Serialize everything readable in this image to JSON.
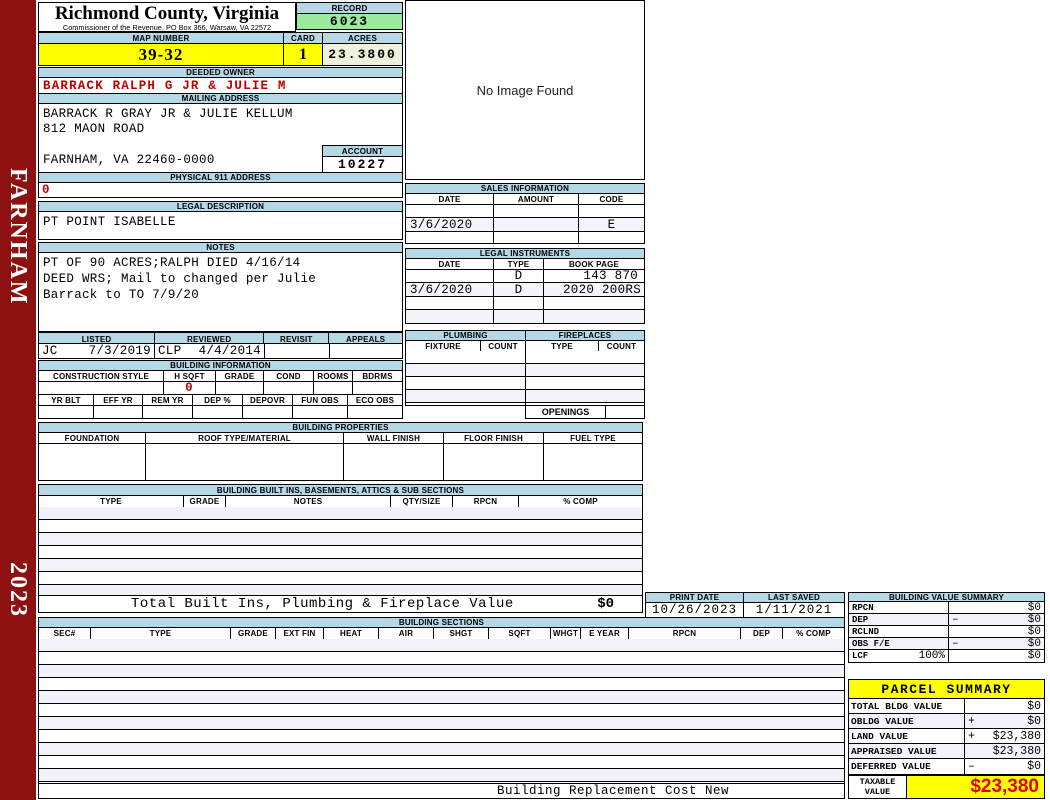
{
  "colors": {
    "sidebar_red": "#8E1111",
    "section_header_blue": "#B4D8E6",
    "record_green": "#9CEB9C",
    "highlight_yellow": "#FFFF00",
    "acres_beige": "#EFEFDC",
    "alert_red": "#C00000",
    "taxable_red": "#E60000",
    "row_stripe": "#F1F2FA"
  },
  "sidebar": {
    "district": "FARNHAM",
    "year": "2023"
  },
  "county_header": {
    "title": "Richmond County, Virginia",
    "subtitle": "Commissioner of the Revenue, PO Box 366, Warsaw, VA 22572"
  },
  "record": {
    "label": "RECORD",
    "value": "6023"
  },
  "parcel_header": {
    "map_number_label": "MAP NUMBER",
    "map_number": "39-32",
    "card_label": "CARD",
    "card": "1",
    "acres_label": "ACRES",
    "acres": "23.3800"
  },
  "owner": {
    "deeded_owner_label": "DEEDED OWNER",
    "deeded_owner": "BARRACK RALPH G JR & JULIE M",
    "mailing_label": "MAILING ADDRESS",
    "mailing_lines": [
      "BARRACK R GRAY JR & JULIE KELLUM",
      "812 MAON ROAD",
      "FARNHAM, VA 22460-0000"
    ],
    "account_label": "ACCOUNT",
    "account": "10227",
    "physical_911_label": "PHYSICAL 911 ADDRESS",
    "physical_911": "0"
  },
  "legal_description": {
    "label": "LEGAL DESCRIPTION",
    "text": "PT POINT ISABELLE"
  },
  "notes": {
    "label": "NOTES",
    "lines": [
      "PT OF 90 ACRES;RALPH DIED 4/16/14",
      "DEED WRS; Mail to changed per Julie",
      "Barrack to TO 7/9/20"
    ]
  },
  "review": {
    "columns": [
      "LISTED",
      "REVIEWED",
      "REVISIT",
      "APPEALS"
    ],
    "listed_by": "JC",
    "listed_date": "7/3/2019",
    "reviewed_by": "CLP",
    "reviewed_date": "4/4/2014",
    "revisit": "",
    "appeals": ""
  },
  "building_information": {
    "title": "BUILDING INFORMATION",
    "row1_columns": [
      "CONSTRUCTION STYLE",
      "H SQFT",
      "GRADE",
      "COND",
      "ROOMS",
      "BDRMS"
    ],
    "h_sqft": "0",
    "row2_columns": [
      "YR BLT",
      "EFF YR",
      "REM YR",
      "DEP %",
      "DEPOVR",
      "FUN OBS",
      "ECO OBS"
    ]
  },
  "building_properties": {
    "title": "BUILDING PROPERTIES",
    "columns": [
      "FOUNDATION",
      "ROOF TYPE/MATERIAL",
      "WALL FINISH",
      "FLOOR FINISH",
      "FUEL TYPE"
    ]
  },
  "built_ins": {
    "title": "BUILDING BUILT INS, BASEMENTS, ATTICS & SUB SECTIONS",
    "columns": [
      "TYPE",
      "GRADE",
      "NOTES",
      "QTY/SIZE",
      "RPCN",
      "% COMP"
    ],
    "total_label": "Total Built Ins, Plumbing & Fireplace Value",
    "total_value": "$0"
  },
  "image_panel": {
    "message": "No Image Found"
  },
  "sales": {
    "title": "SALES INFORMATION",
    "columns": [
      "DATE",
      "AMOUNT",
      "CODE"
    ],
    "rows": [
      {
        "date": "",
        "amount": "",
        "code": ""
      },
      {
        "date": "3/6/2020",
        "amount": "",
        "code": "E"
      },
      {
        "date": "",
        "amount": "",
        "code": ""
      }
    ]
  },
  "legal_instruments": {
    "title": "LEGAL INSTRUMENTS",
    "columns": [
      "DATE",
      "TYPE",
      "BOOK PAGE"
    ],
    "rows": [
      {
        "date": "",
        "type": "D",
        "book_page": "143 870"
      },
      {
        "date": "3/6/2020",
        "type": "D",
        "book_page": "2020 200RS"
      },
      {
        "date": "",
        "type": "",
        "book_page": ""
      },
      {
        "date": "",
        "type": "",
        "book_page": ""
      }
    ]
  },
  "plumbing": {
    "title": "PLUMBING",
    "columns": [
      "FIXTURE",
      "COUNT"
    ]
  },
  "fireplaces": {
    "title": "FIREPLACES",
    "columns": [
      "TYPE",
      "COUNT"
    ],
    "openings_label": "OPENINGS",
    "openings": ""
  },
  "print_info": {
    "print_date_label": "PRINT DATE",
    "print_date": "10/26/2023",
    "last_saved_label": "LAST SAVED",
    "last_saved": "1/11/2021"
  },
  "building_value_summary": {
    "title": "BUILDING VALUE SUMMARY",
    "rows": [
      {
        "label": "RPCN",
        "pct": "",
        "op": "",
        "value": "$0"
      },
      {
        "label": "DEP",
        "pct": "",
        "op": "–",
        "value": "$0"
      },
      {
        "label": "RCLND",
        "pct": "",
        "op": "",
        "value": "$0"
      },
      {
        "label": "OBS F/E",
        "pct": "",
        "op": "–",
        "value": "$0"
      },
      {
        "label": "LCF",
        "pct": "100%",
        "op": "",
        "value": "$0"
      }
    ]
  },
  "building_sections": {
    "title": "BUILDING SECTIONS",
    "columns": [
      "SEC#",
      "TYPE",
      "GRADE",
      "EXT FIN",
      "HEAT",
      "AIR",
      "SHGT",
      "SQFT",
      "WHGT",
      "E YEAR",
      "RPCN",
      "DEP",
      "% COMP"
    ],
    "footer": "Building Replacement Cost New"
  },
  "parcel_summary": {
    "title": "PARCEL SUMMARY",
    "rows": [
      {
        "label": "TOTAL BLDG VALUE",
        "op": "",
        "value": "$0"
      },
      {
        "label": "OBLDG VALUE",
        "op": "+",
        "value": "$0"
      },
      {
        "label": "LAND VALUE",
        "op": "+",
        "value": "$23,380"
      },
      {
        "label": "APPRAISED VALUE",
        "op": "",
        "value": "$23,380"
      },
      {
        "label": "DEFERRED VALUE",
        "op": "–",
        "value": "$0"
      }
    ],
    "taxable_label": "TAXABLE VALUE",
    "taxable_value": "$23,380"
  }
}
